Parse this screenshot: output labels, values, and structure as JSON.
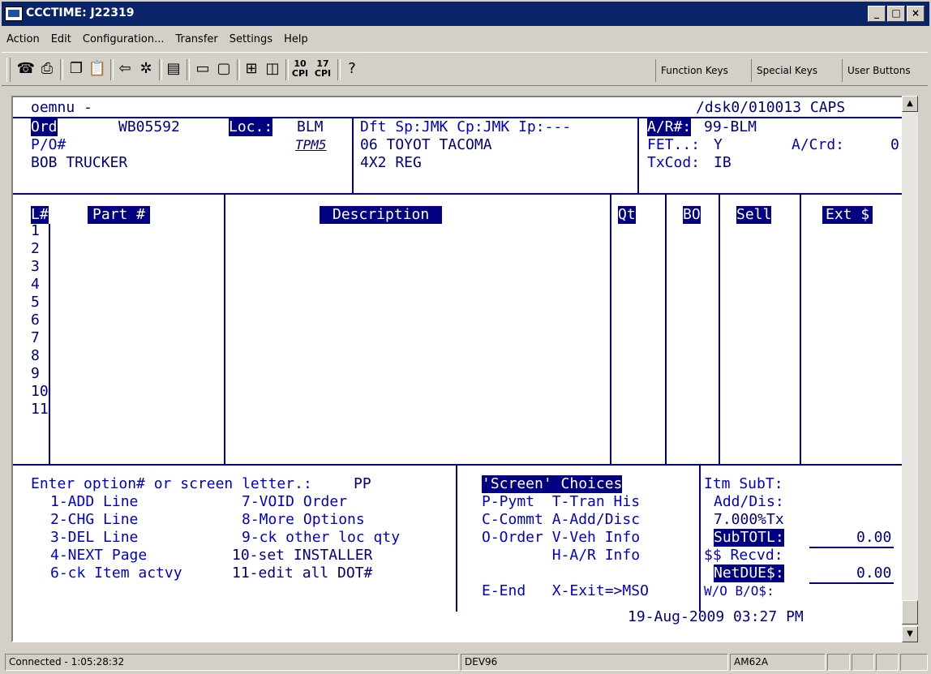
{
  "window": {
    "title": "CCCTIME: J22319",
    "min": "_",
    "max": "□",
    "close": "×"
  },
  "menu": [
    "Action",
    "Edit",
    "Configuration...",
    "Transfer",
    "Settings",
    "Help"
  ],
  "toolbar": {
    "cpi10": "10",
    "cpi17": "17",
    "function_keys": "Function Keys",
    "special_keys": "Special Keys",
    "user_buttons": "User Buttons"
  },
  "header": {
    "oemnu": "oemnu -",
    "path": "/dsk0/010013 CAPS",
    "ord_label": "Ord",
    "ord_value": "WB05592",
    "loc_label": "Loc.:",
    "loc_value": "BLM",
    "dft": "Dft Sp:JMK Cp:JMK Ip:---",
    "ar_label": "A/R#:",
    "ar_value": "99-BLM",
    "po_label": "P/O#",
    "tpm": "TPM5",
    "vehicle": "06 TOYOT TACOMA",
    "fet_label": "FET..:",
    "fet_value": "Y",
    "acrd_label": "A/Crd:",
    "acrd_value": "0",
    "customer": "BOB TRUCKER",
    "vehicle2": "4X2 REG",
    "txcod_label": "TxCod:",
    "txcod_value": "IB"
  },
  "table": {
    "cols": [
      "L#",
      "Part #",
      "Description",
      "Qt",
      "BO",
      "Sell",
      "Ext $"
    ],
    "lines": [
      "1",
      "2",
      "3",
      "4",
      "5",
      "6",
      "7",
      "8",
      "9",
      "10",
      "11"
    ]
  },
  "footer": {
    "prompt_label": "Enter option# or screen letter.:",
    "prompt_value": "PP",
    "opts_left": [
      "1-ADD Line",
      "2-CHG Line",
      "3-DEL Line",
      "4-NEXT Page",
      "6-ck Item actvy"
    ],
    "opts_right": [
      "7-VOID Order",
      "8-More Options",
      "9-ck other loc qty",
      "10-set INSTALLER",
      "11-edit all DOT#"
    ],
    "screen_choices": "'Screen' Choices",
    "choices": [
      "P-Pymt  T-Tran His",
      "C-Commt A-Add/Disc",
      "O-Order V-Veh Info",
      "        H-A/R Info",
      "E-End   X-Exit=>MSO"
    ],
    "totals": {
      "itm_subt": "Itm SubT:",
      "add_dis": "Add/Dis:",
      "tax": "7.000%Tx",
      "subtotl": "SubTOTL:",
      "subtotl_val": "0.00",
      "recvd": "$$ Recvd:",
      "netdue": "NetDUE$:",
      "netdue_val": "0.00",
      "wo": "W/O B/O$:"
    },
    "datetime": "19-Aug-2009 03:27 PM"
  },
  "status": {
    "connected": "Connected - 1:05:28:32",
    "host": "DEV96",
    "term": "AM62A"
  }
}
